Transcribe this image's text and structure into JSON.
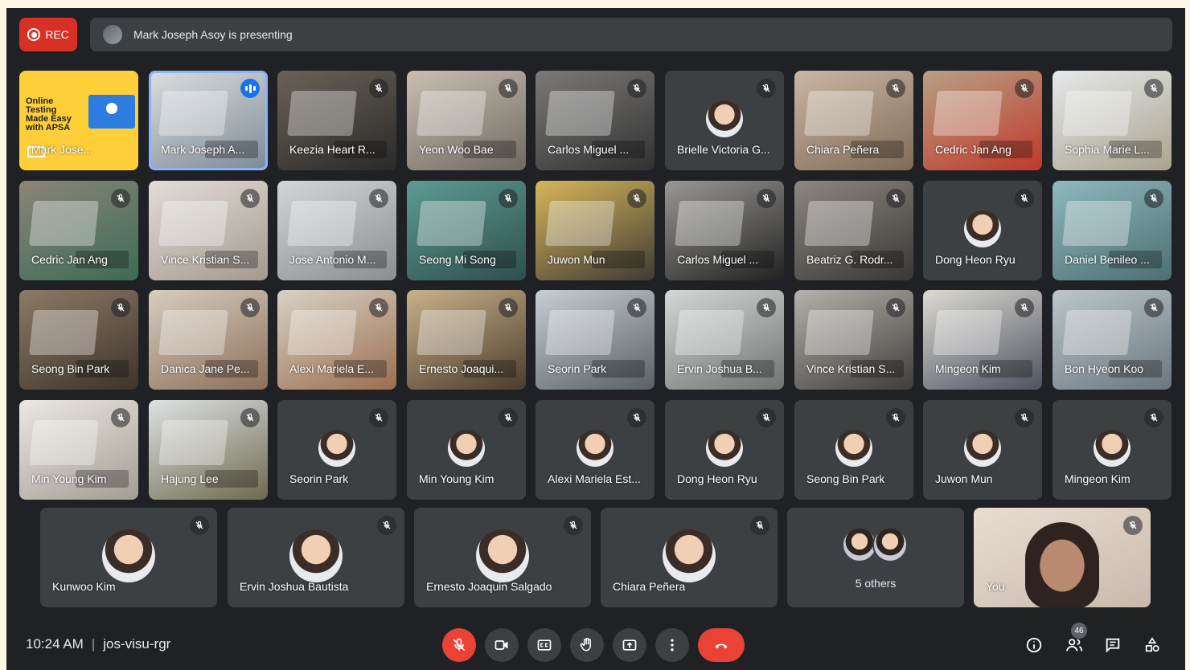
{
  "recording": {
    "label": "REC"
  },
  "presenting": {
    "text": "Mark Joseph Asoy is presenting"
  },
  "promo": {
    "text": "Online Testing Made Easy with APSA",
    "name": "Mark Jose..."
  },
  "tiles": [
    {
      "name": "Mark Joseph A...",
      "kind": "cam",
      "speaking": true,
      "c1": "#dcdedf",
      "c2": "#7d8a96"
    },
    {
      "name": "Keezia Heart R...",
      "kind": "cam",
      "c1": "#6a6257",
      "c2": "#2a2a2a"
    },
    {
      "name": "Yeon Woo Bae",
      "kind": "cam",
      "c1": "#c8bfb0",
      "c2": "#6f6a62"
    },
    {
      "name": "Carlos Miguel ...",
      "kind": "cam",
      "c1": "#7c7a78",
      "c2": "#323232"
    },
    {
      "name": "Brielle Victoria G...",
      "kind": "avatar"
    },
    {
      "name": "Chiara Peñera",
      "kind": "cam",
      "c1": "#c9b7a3",
      "c2": "#7f6b58"
    },
    {
      "name": "Cedric Jan Ang",
      "kind": "cam",
      "c1": "#b7a084",
      "c2": "#c0392b"
    },
    {
      "name": "Sophia Marie L...",
      "kind": "cam",
      "c1": "#e6e8ea",
      "c2": "#a9a48f"
    },
    {
      "name": "Cedric Jan Ang",
      "kind": "cam",
      "c1": "#8c8577",
      "c2": "#3c6b56"
    },
    {
      "name": "Vince Kristian S...",
      "kind": "cam",
      "c1": "#e2ddd6",
      "c2": "#a29a90"
    },
    {
      "name": "Jose Antonio M...",
      "kind": "cam",
      "c1": "#d3d6d8",
      "c2": "#8a8e90"
    },
    {
      "name": "Seong Mi Song",
      "kind": "cam",
      "c1": "#5d9b94",
      "c2": "#2f4f4c"
    },
    {
      "name": "Juwon Mun",
      "kind": "cam",
      "c1": "#d7b65a",
      "c2": "#3e3b35"
    },
    {
      "name": "Carlos Miguel ...",
      "kind": "cam",
      "c1": "#9a9895",
      "c2": "#222"
    },
    {
      "name": "Beatriz G. Rodr...",
      "kind": "cam",
      "c1": "#8c8781",
      "c2": "#3a3735"
    },
    {
      "name": "Dong Heon Ryu",
      "kind": "avatar"
    },
    {
      "name": "Daniel Benileo ...",
      "kind": "cam",
      "c1": "#8fb9bd",
      "c2": "#4c6f72"
    },
    {
      "name": "Seong Bin Park",
      "kind": "cam",
      "c1": "#8d7a67",
      "c2": "#3d342b"
    },
    {
      "name": "Danica Jane Pe...",
      "kind": "cam",
      "c1": "#d6cdc0",
      "c2": "#8c6f58"
    },
    {
      "name": "Alexi Mariela E...",
      "kind": "cam",
      "c1": "#d7d2c6",
      "c2": "#9b6e4f"
    },
    {
      "name": "Ernesto Joaqui...",
      "kind": "cam",
      "c1": "#c9b28a",
      "c2": "#4a3d2e"
    },
    {
      "name": "Seorin Park",
      "kind": "cam",
      "c1": "#c8ced3",
      "c2": "#5a5f63"
    },
    {
      "name": "Ervin Joshua B...",
      "kind": "cam",
      "c1": "#d4d7d6",
      "c2": "#6f7472"
    },
    {
      "name": "Vince Kristian S...",
      "kind": "cam",
      "c1": "#b5b2ad",
      "c2": "#3f3d3a"
    },
    {
      "name": "Mingeon Kim",
      "kind": "cam",
      "c1": "#dcdad2",
      "c2": "#4f5360"
    },
    {
      "name": "Bon Hyeon Koo",
      "kind": "cam",
      "c1": "#bcc6cc",
      "c2": "#6b7780"
    },
    {
      "name": "Min Young Kim",
      "kind": "cam",
      "c1": "#ebe8e2",
      "c2": "#a39e94"
    },
    {
      "name": "Hajung Lee",
      "kind": "cam",
      "c1": "#dfe2e3",
      "c2": "#6d6a4f"
    },
    {
      "name": "Seorin Park",
      "kind": "avatar"
    },
    {
      "name": "Min Young Kim",
      "kind": "avatar"
    },
    {
      "name": "Alexi Mariela Est...",
      "kind": "avatar"
    },
    {
      "name": "Dong Heon Ryu",
      "kind": "avatar"
    },
    {
      "name": "Seong Bin Park",
      "kind": "avatar"
    },
    {
      "name": "Juwon Mun",
      "kind": "avatar"
    },
    {
      "name": "Mingeon Kim",
      "kind": "avatar"
    }
  ],
  "bottom_row": [
    {
      "name": "Kunwoo Kim"
    },
    {
      "name": "Ervin Joshua Bautista"
    },
    {
      "name": "Ernesto Joaquin Salgado"
    },
    {
      "name": "Chiara Peñera"
    }
  ],
  "others": {
    "label": "5 others"
  },
  "self": {
    "name": "You"
  },
  "meeting": {
    "time": "10:24 AM",
    "separator": "|",
    "code": "jos-visu-rgr"
  },
  "participants": {
    "count": "46"
  },
  "colors": {
    "background": "#202124",
    "tile": "#3c4043",
    "danger": "#ea4335",
    "accent": "#1a73e8"
  }
}
